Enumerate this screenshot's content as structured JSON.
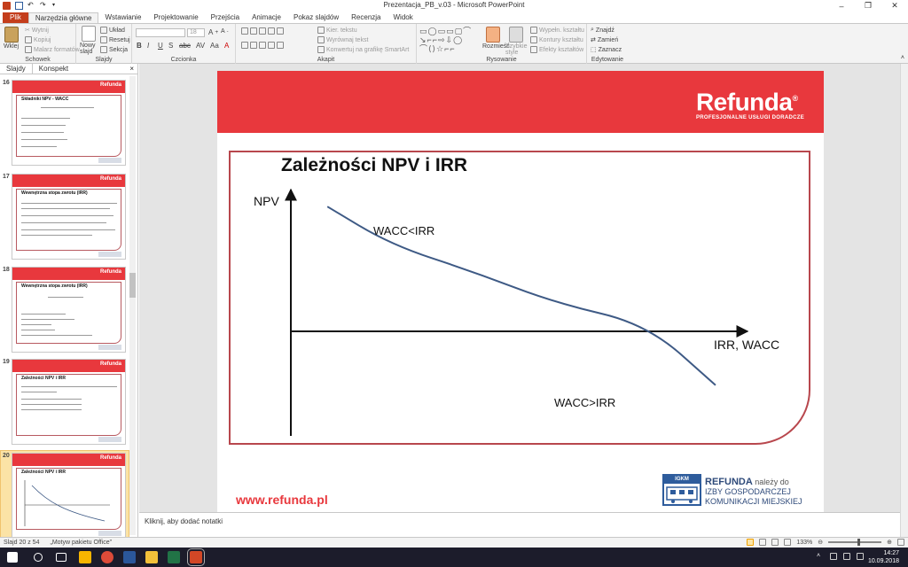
{
  "window": {
    "title": "Prezentacja_PB_v.03 - Microsoft PowerPoint",
    "controls": [
      "–",
      "❐",
      "✕"
    ]
  },
  "ribbon_tabs": [
    "Plik",
    "Narzędzia główne",
    "Wstawianie",
    "Projektowanie",
    "Przejścia",
    "Animacje",
    "Pokaz slajdów",
    "Recenzja",
    "Widok"
  ],
  "ribbon": {
    "clipboard": {
      "label": "Schowek",
      "paste": "Wklej",
      "cut": "Wytnij",
      "copy": "Kopiuj",
      "format_painter": "Malarz formatów"
    },
    "slides": {
      "label": "Slajdy",
      "new_slide": "Nowy slajd",
      "layout": "Układ",
      "reset": "Resetuj",
      "section": "Sekcja"
    },
    "font": {
      "label": "Czcionka",
      "size": "18"
    },
    "paragraph": {
      "label": "Akapit",
      "text_direction": "Kier. tekstu",
      "align_text": "Wyrównaj tekst",
      "smartart": "Konwertuj na grafikę SmartArt"
    },
    "drawing": {
      "label": "Rysowanie",
      "arrange": "Rozmieść",
      "quick_styles": "Szybkie style",
      "fill": "Wypełn. kształtu",
      "outline": "Kontury kształtu",
      "effects": "Efekty kształtów"
    },
    "editing": {
      "label": "Edytowanie",
      "find": "Znajdź",
      "replace": "Zamień",
      "select": "Zaznacz"
    }
  },
  "left_panel": {
    "tabs": [
      "Slajdy",
      "Konspekt"
    ],
    "close": "×",
    "thumbnails": [
      {
        "num": "16",
        "title": "Składniki NPV - WACC",
        "logo": "Refunda"
      },
      {
        "num": "17",
        "title": "Wewnętrzna stopa zwrotu (IRR)",
        "logo": "Refunda"
      },
      {
        "num": "18",
        "title": "Wewnętrzna stopa zwrotu (IRR)",
        "logo": "Refunda"
      },
      {
        "num": "19",
        "title": "Zależności NPV i IRR",
        "logo": "Refunda"
      },
      {
        "num": "20",
        "title": "Zależności NPV i IRR",
        "logo": "Refunda"
      }
    ]
  },
  "slide": {
    "logo_big": "Refunda",
    "logo_reg": "®",
    "logo_small": "PROFESJONALNE USŁUGI DORADCZE",
    "title": "Zależności NPV i IRR",
    "url": "www.refunda.pl",
    "badge": "IGKM",
    "footer_line1_bold": "REFUNDA",
    "footer_line1_rest": " należy do",
    "footer_line2": "IZBY GOSPODARCZEJ",
    "footer_line3": "KOMUNIKACJI MIEJSKIEJ"
  },
  "chart_data": {
    "type": "line",
    "title": "Zależności NPV i IRR",
    "ylabel": "NPV",
    "xlabel": "IRR, WACC",
    "annotations": [
      "WACC<IRR",
      "WACC>IRR"
    ],
    "grid": false,
    "series": [
      {
        "color": "#3e5a85",
        "points": [
          [
            0.08,
            0.88
          ],
          [
            0.22,
            0.61
          ],
          [
            0.4,
            0.42
          ],
          [
            0.58,
            0.2
          ],
          [
            0.78,
            0.05
          ],
          [
            0.93,
            -0.38
          ]
        ]
      }
    ]
  },
  "notes": {
    "placeholder": "Kliknij, aby dodać notatki"
  },
  "status": {
    "slide": "Slajd 20 z 54",
    "theme": "„Motyw pakietu Office”",
    "zoom": "133%"
  },
  "taskbar": {
    "time": "14:27",
    "date": "10.09.2018"
  }
}
